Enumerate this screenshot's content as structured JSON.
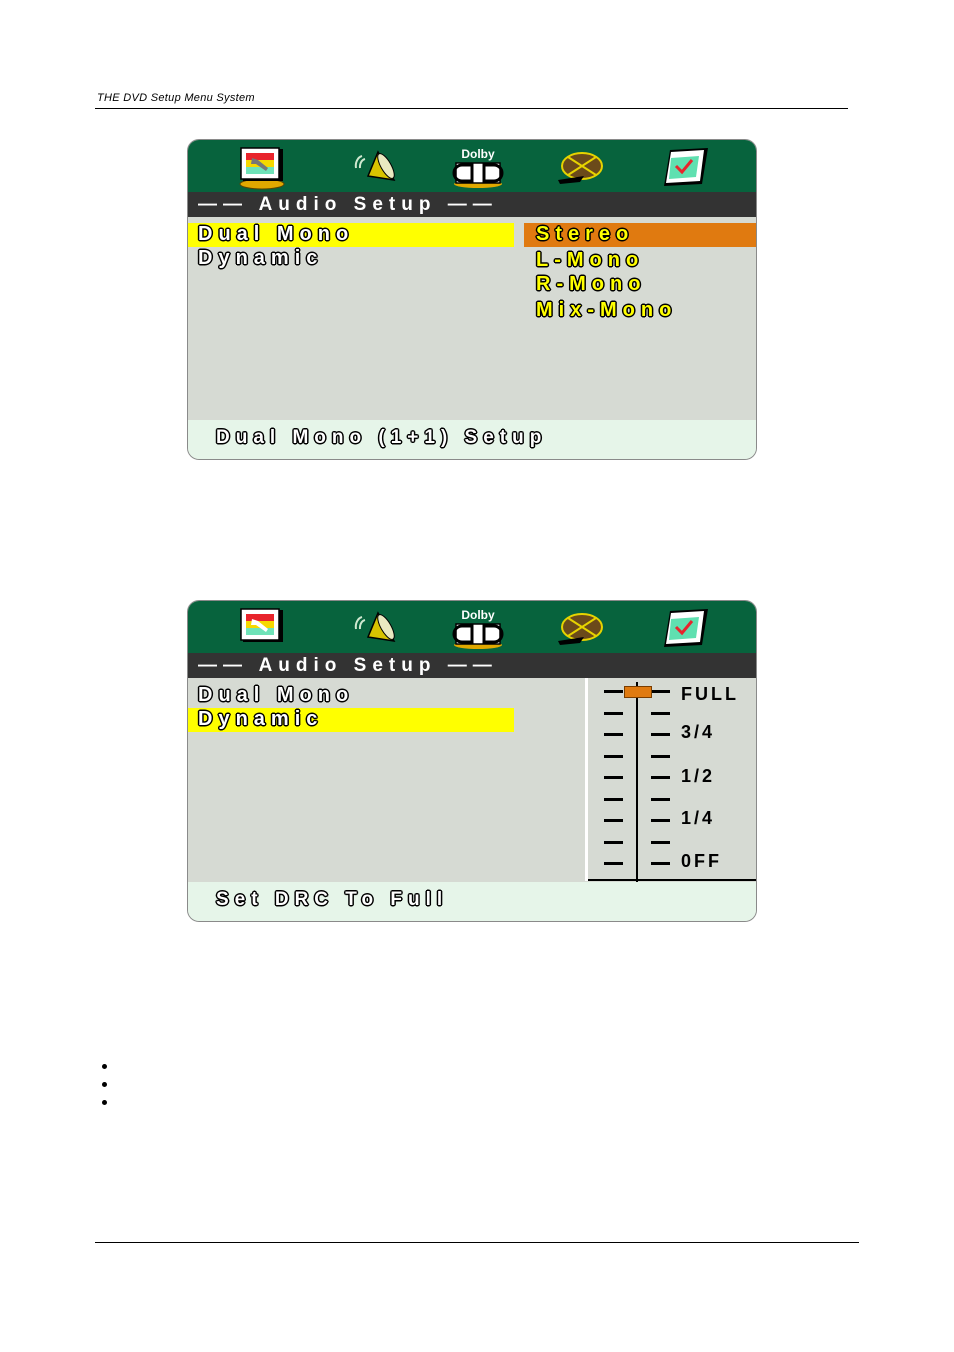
{
  "page": {
    "header": "THE DVD Setup Menu System",
    "bullets": 3
  },
  "icons": [
    {
      "name": "general-setup-tv-icon"
    },
    {
      "name": "speaker-setup-icon"
    },
    {
      "name": "dolby-digital-setup-icon",
      "label": "Dolby"
    },
    {
      "name": "video-reel-setup-icon"
    },
    {
      "name": "preference-chart-icon"
    }
  ],
  "screen1": {
    "title": "—— Audio Setup ——",
    "menu": [
      {
        "label": "Dual Mono",
        "selected": true
      },
      {
        "label": "Dynamic",
        "selected": false
      }
    ],
    "options": [
      {
        "label": "Stereo",
        "selected": true
      },
      {
        "label": "L-Mono",
        "selected": false
      },
      {
        "label": "R-Mono",
        "selected": false
      },
      {
        "label": "Mix-Mono",
        "selected": false
      }
    ],
    "status": "Dual Mono (1+1) Setup"
  },
  "screen2": {
    "title": "—— Audio Setup ——",
    "menu": [
      {
        "label": "Dual Mono",
        "selected": false
      },
      {
        "label": "Dynamic",
        "selected": true
      }
    ],
    "drc": {
      "levels": [
        "FULL",
        "3/4",
        "1/2",
        "1/4",
        "0FF"
      ],
      "current": "FULL",
      "value_fraction": 1.0
    },
    "status": "Set DRC To Full"
  },
  "colors": {
    "icon_bar": "#07633d",
    "title_bar": "#333333",
    "menu_highlight": "#ffff00",
    "option_highlight": "#e07a10",
    "content_bg": "#d6dad3",
    "status_bg": "#e6f5e9"
  }
}
